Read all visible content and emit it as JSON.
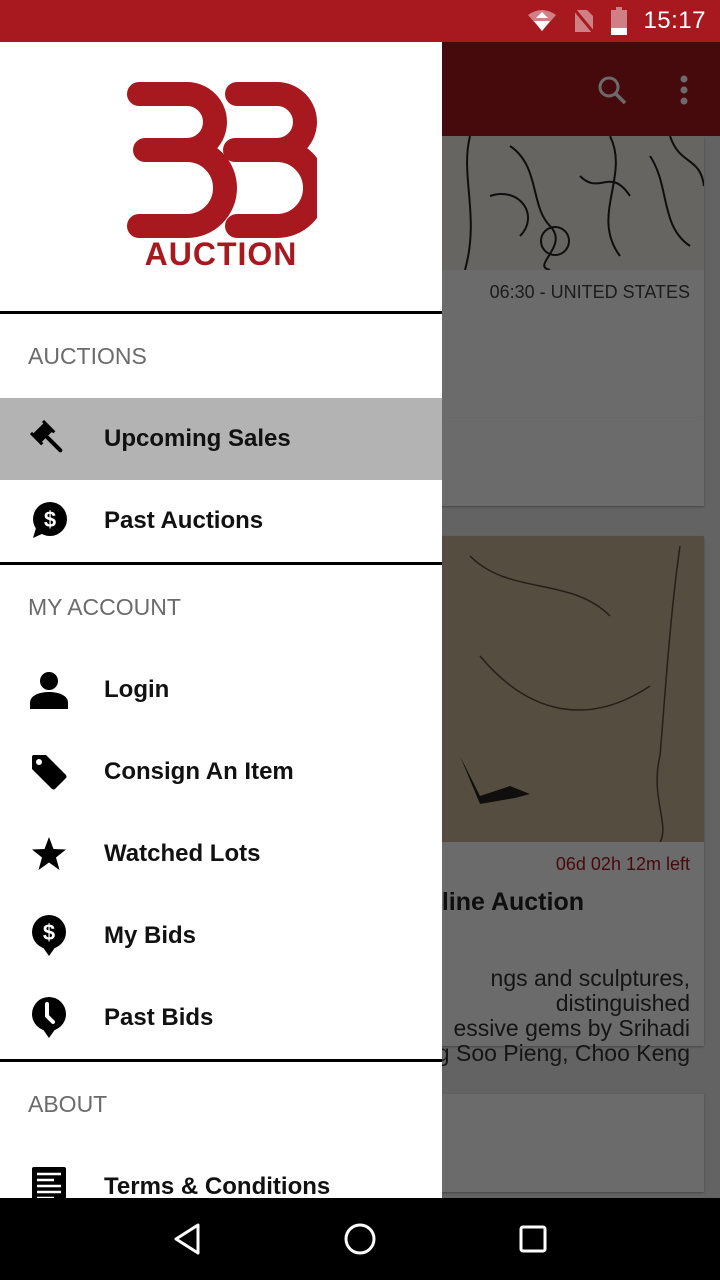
{
  "status_bar": {
    "time": "15:17",
    "icons": [
      "wifi-icon",
      "no-sim-icon",
      "battery-low-icon"
    ]
  },
  "colors": {
    "brand_red": "#a8191f",
    "active_item_bg": "#b3b3b3"
  },
  "app": {
    "toolbar": {
      "icons": [
        "search-icon",
        "more-vert-icon"
      ]
    },
    "cards": [
      {
        "meta": "06:30 - UNITED STATES"
      },
      {
        "meta": "06d 02h 12m left",
        "title_fragment": "line Auction",
        "description_fragment": "ngs and sculptures,\ndistinguished\nessive gems by Srihadi\ng Soo Pieng, Choo Keng"
      }
    ]
  },
  "drawer": {
    "logo": {
      "digits": "33",
      "wordmark": "AUCTION"
    },
    "sections": [
      {
        "label": "AUCTIONS",
        "items": [
          {
            "label": "Upcoming Sales",
            "icon": "gavel-icon",
            "active": true
          },
          {
            "label": "Past Auctions",
            "icon": "dollar-chat-icon",
            "active": false
          }
        ]
      },
      {
        "label": "MY ACCOUNT",
        "items": [
          {
            "label": "Login",
            "icon": "person-icon",
            "active": false
          },
          {
            "label": "Consign An Item",
            "icon": "tag-icon",
            "active": false
          },
          {
            "label": "Watched Lots",
            "icon": "star-icon",
            "active": false
          },
          {
            "label": "My Bids",
            "icon": "dollar-pin-icon",
            "active": false
          },
          {
            "label": "Past Bids",
            "icon": "clock-pin-icon",
            "active": false
          }
        ]
      },
      {
        "label": "ABOUT",
        "items": [
          {
            "label": "Terms & Conditions",
            "icon": "document-icon",
            "active": false
          }
        ]
      }
    ]
  },
  "nav_bar": {
    "buttons": [
      "back-icon",
      "home-icon",
      "recents-icon"
    ]
  }
}
